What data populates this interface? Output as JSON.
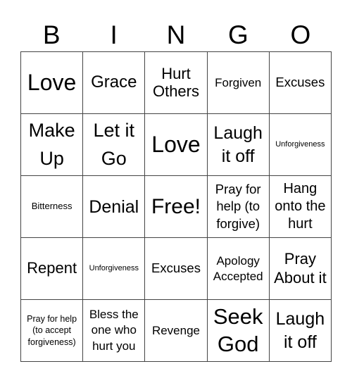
{
  "header": {
    "letters": [
      "B",
      "I",
      "N",
      "G",
      "O"
    ]
  },
  "cells": [
    [
      "Love",
      "Grace",
      "Hurt Others",
      "Forgiven",
      "Excuses"
    ],
    [
      "Make Up",
      "Let it Go",
      "Love",
      "Laugh it off",
      "Unforgiveness"
    ],
    [
      "Bitterness",
      "Denial",
      "Free!",
      "Pray for help (to forgive)",
      "Hang onto the hurt"
    ],
    [
      "Repent",
      "Unforgiveness",
      "Excuses",
      "Apology Accepted",
      "Pray About it"
    ],
    [
      "Pray for help (to accept forgiveness)",
      "Bless the one who hurt you",
      "Revenge",
      "Seek God",
      "Laugh it off"
    ]
  ]
}
